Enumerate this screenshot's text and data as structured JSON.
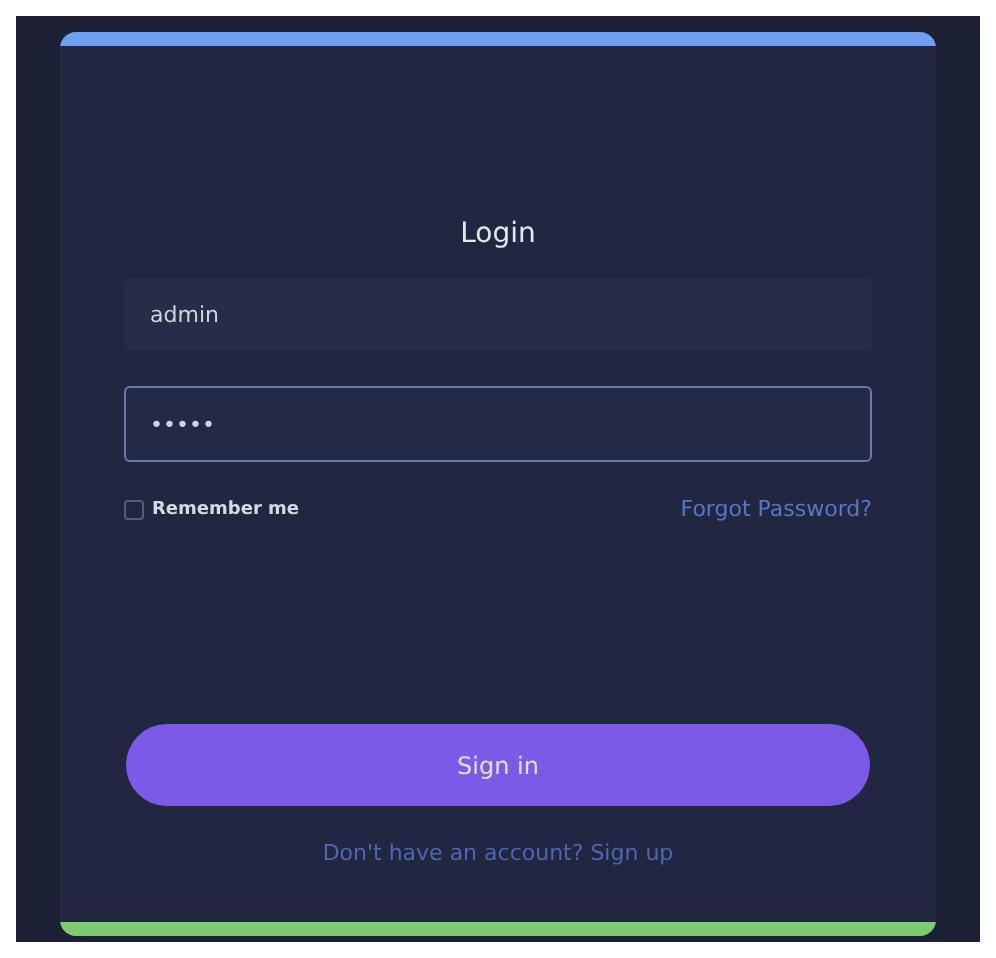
{
  "title": "Login",
  "username": {
    "value": "admin",
    "focused": false
  },
  "password": {
    "value": "•••••",
    "focused": true
  },
  "remember": {
    "label": "Remember me",
    "checked": false
  },
  "forgot_link": "Forgot Password?",
  "sign_in_button": "Sign in",
  "signup_prompt": {
    "text": "Don't have an account?",
    "link": "Sign up"
  }
}
